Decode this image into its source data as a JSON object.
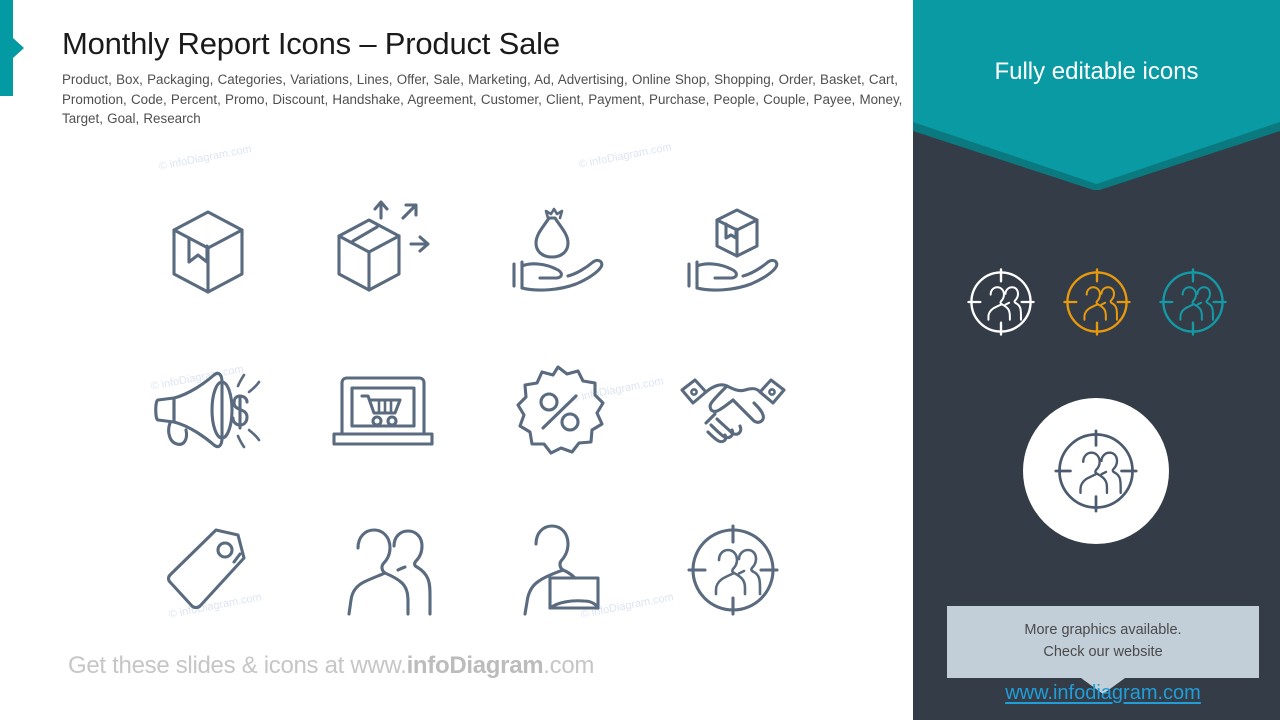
{
  "slide": {
    "title": "Monthly Report Icons – Product Sale",
    "subtitle": "Product, Box, Packaging, Categories, Variations, Lines, Offer, Sale, Marketing, Ad, Advertising, Online Shop, Shopping, Order, Basket, Cart, Promotion, Code, Percent, Promo, Discount, Handshake, Agreement, Customer, Client, Payment, Purchase, People, Couple, Payee, Money, Target, Goal, Research",
    "accent_color": "#049aa4",
    "sidebar_bg": "#343d47"
  },
  "footer": {
    "prefix": "Get these slides & icons at www.",
    "brand": "infoDiagram",
    "suffix": ".com"
  },
  "watermark": {
    "text": "© infoDiagram.com"
  },
  "icons": [
    {
      "name": "box-package-icon",
      "label": "Box / Packaging"
    },
    {
      "name": "box-variations-icon",
      "label": "Variations / Lines"
    },
    {
      "name": "hand-money-bag-icon",
      "label": "Offer / Money"
    },
    {
      "name": "hand-box-icon",
      "label": "Product Delivery"
    },
    {
      "name": "megaphone-dollar-icon",
      "label": "Marketing / Advertising"
    },
    {
      "name": "laptop-cart-icon",
      "label": "Online Shop / Shopping"
    },
    {
      "name": "percent-badge-icon",
      "label": "Discount / Promo"
    },
    {
      "name": "handshake-icon",
      "label": "Handshake / Agreement"
    },
    {
      "name": "price-tag-icon",
      "label": "Sale / Price Tag"
    },
    {
      "name": "two-people-icon",
      "label": "People / Couple"
    },
    {
      "name": "person-payment-icon",
      "label": "Payment / Payee"
    },
    {
      "name": "target-people-icon",
      "label": "Target / Goal / Research"
    }
  ],
  "sidebar": {
    "header_title": "Fully editable icons",
    "header_color": "#099aa3",
    "targets": [
      {
        "name": "target-people-white",
        "color": "#ffffff"
      },
      {
        "name": "target-people-orange",
        "color": "#e8990c"
      },
      {
        "name": "target-people-teal",
        "color": "#149aa6"
      }
    ],
    "big_circle": {
      "name": "target-people-featured",
      "circle_color": "#ffffff",
      "icon_color": "#4c5b6e"
    },
    "callout": {
      "line1": "More graphics available.",
      "line2": "Check our website",
      "bg_color": "#c2ced8"
    },
    "link": {
      "text": "www.infodiagram.com",
      "color": "#1f9ed9"
    }
  }
}
